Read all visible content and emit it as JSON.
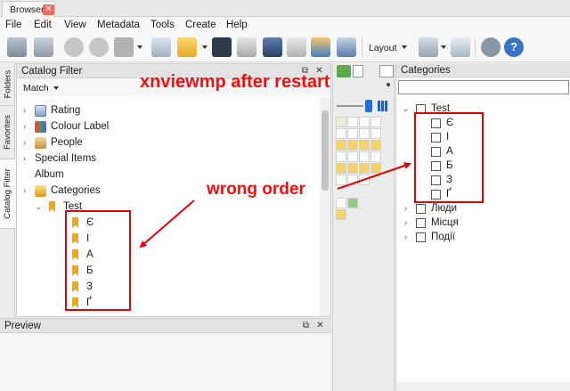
{
  "window": {
    "tab_title": "Browser",
    "tab_close_icon": "close-icon"
  },
  "menu": [
    "File",
    "Edit",
    "View",
    "Metadata",
    "Tools",
    "Create",
    "Help"
  ],
  "toolbar": {
    "layout_label": "Layout"
  },
  "side_tabs": [
    "Folders",
    "Favorites",
    "Catalog Filter"
  ],
  "catalog_filter": {
    "title": "Catalog Filter",
    "match_label": "Match",
    "items": [
      {
        "label": "Rating",
        "icon": "rating-icon"
      },
      {
        "label": "Colour Label",
        "icon": "colour-label-icon"
      },
      {
        "label": "People",
        "icon": "people-icon"
      },
      {
        "label": "Special Items"
      },
      {
        "label": "Album"
      },
      {
        "label": "Categories",
        "icon": "categories-icon"
      },
      {
        "label": "Test",
        "icon": "bookmark-icon"
      }
    ],
    "test_children": [
      "Є",
      "І",
      "А",
      "Б",
      "З",
      "Ґ"
    ]
  },
  "preview": {
    "title": "Preview"
  },
  "categories_panel": {
    "title": "Categories",
    "root": "Test",
    "test_children": [
      "Є",
      "І",
      "А",
      "Б",
      "З",
      "Ґ"
    ],
    "others": [
      "Люди",
      "Місця",
      "Події"
    ]
  },
  "annotations": {
    "headline": "xnviewmp after restart",
    "wrong_order": "wrong order",
    "color": "#ff0a0a"
  },
  "colors": {
    "bookmark": "#f3a51b",
    "accent_blue": "#1e6fd9",
    "annotation_red": "#e60000"
  }
}
